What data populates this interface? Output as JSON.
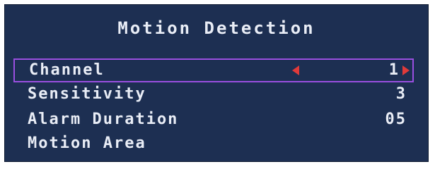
{
  "colors": {
    "background": "#1d2f52",
    "text": "#e9edf6",
    "selection_border": "#9a4fe0",
    "arrow": "#e03a3a"
  },
  "title": "Motion Detection",
  "menu": {
    "items": [
      {
        "label": "Channel",
        "value": "1",
        "selected": true,
        "left_arrow_icon": "arrow-left-icon",
        "right_arrow_icon": "arrow-right-icon"
      },
      {
        "label": "Sensitivity",
        "value": "3"
      },
      {
        "label": "Alarm Duration",
        "value": "05"
      },
      {
        "label": "Motion Area",
        "value": ""
      }
    ]
  }
}
